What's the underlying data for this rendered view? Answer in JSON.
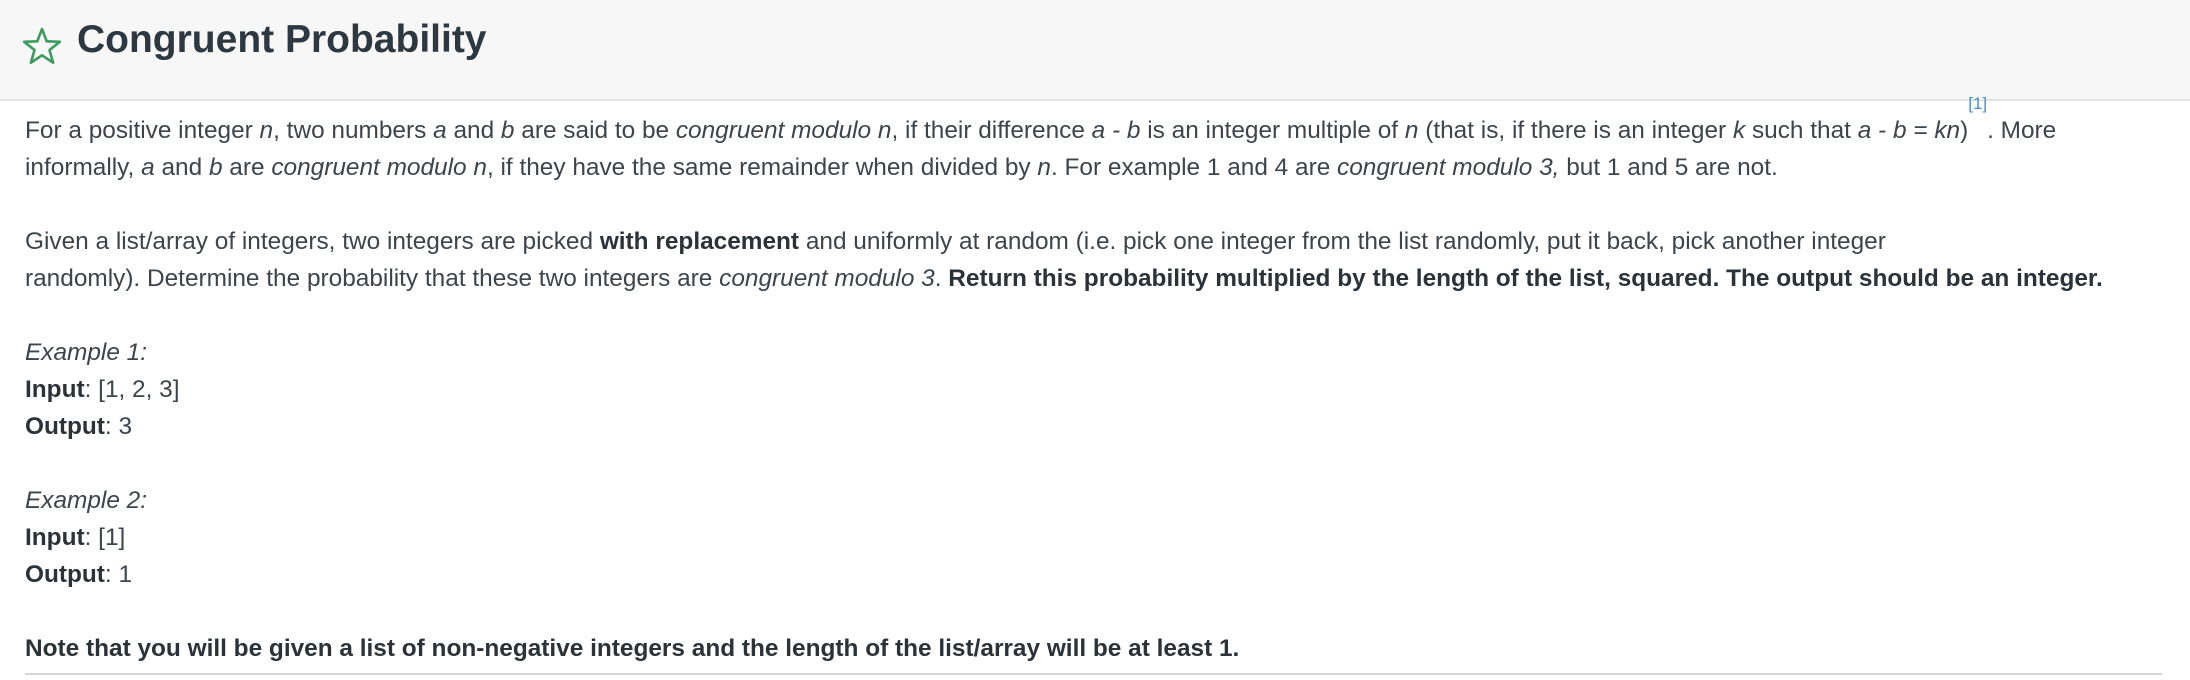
{
  "header": {
    "title": "Congruent Probability",
    "star_icon": "star-outline-icon",
    "star_color": "#3c9a5f"
  },
  "para1": {
    "line1": {
      "s1": "For a positive integer ",
      "n1": "n",
      "s2": ", two numbers ",
      "a1": "a",
      "s3": " and ",
      "b1": "b",
      "s4": " are said to be ",
      "cong1": "congruent modulo n",
      "s5": ", if their difference ",
      "diff": "a - b",
      "s6": " is an integer multiple of ",
      "n2": "n",
      "s7": " (that is, if there is an integer ",
      "k": "k",
      "s8": " such that ",
      "eq": "a - b = kn",
      "s9": ")",
      "ref": "[1]",
      "s10": ". More"
    },
    "line2": {
      "s1": "informally, ",
      "a": "a",
      "s2": " and ",
      "b": "b",
      "s3": " are ",
      "cong": "congruent modulo n",
      "s4": ", if they have the same remainder when divided by ",
      "n": "n",
      "s5": ". For example 1 and 4 are ",
      "cong3": "congruent modulo 3,",
      "s6": " but 1 and 5 are not."
    }
  },
  "para2": {
    "line1": {
      "s1": "Given a list/array of integers, two integers are picked ",
      "bold": "with replacement",
      "s2": " and uniformly at random (i.e. pick one integer from the list randomly, put it back, pick another integer"
    },
    "line2": {
      "s1": "randomly). Determine the probability that these two integers are ",
      "cong3": "congruent modulo 3",
      "s2": ". ",
      "bold": "Return this probability multiplied by the length of the list, squared. The output should be an integer."
    }
  },
  "examples": [
    {
      "title": "Example 1:",
      "input_label": "Input",
      "input_value": ": [1, 2, 3]",
      "output_label": "Output",
      "output_value": ": 3"
    },
    {
      "title": "Example 2:",
      "input_label": "Input",
      "input_value": ": [1]",
      "output_label": "Output",
      "output_value": ": 1"
    }
  ],
  "note": "Note that you will be given a list of non-negative integers and the length of the list/array will be at least 1."
}
